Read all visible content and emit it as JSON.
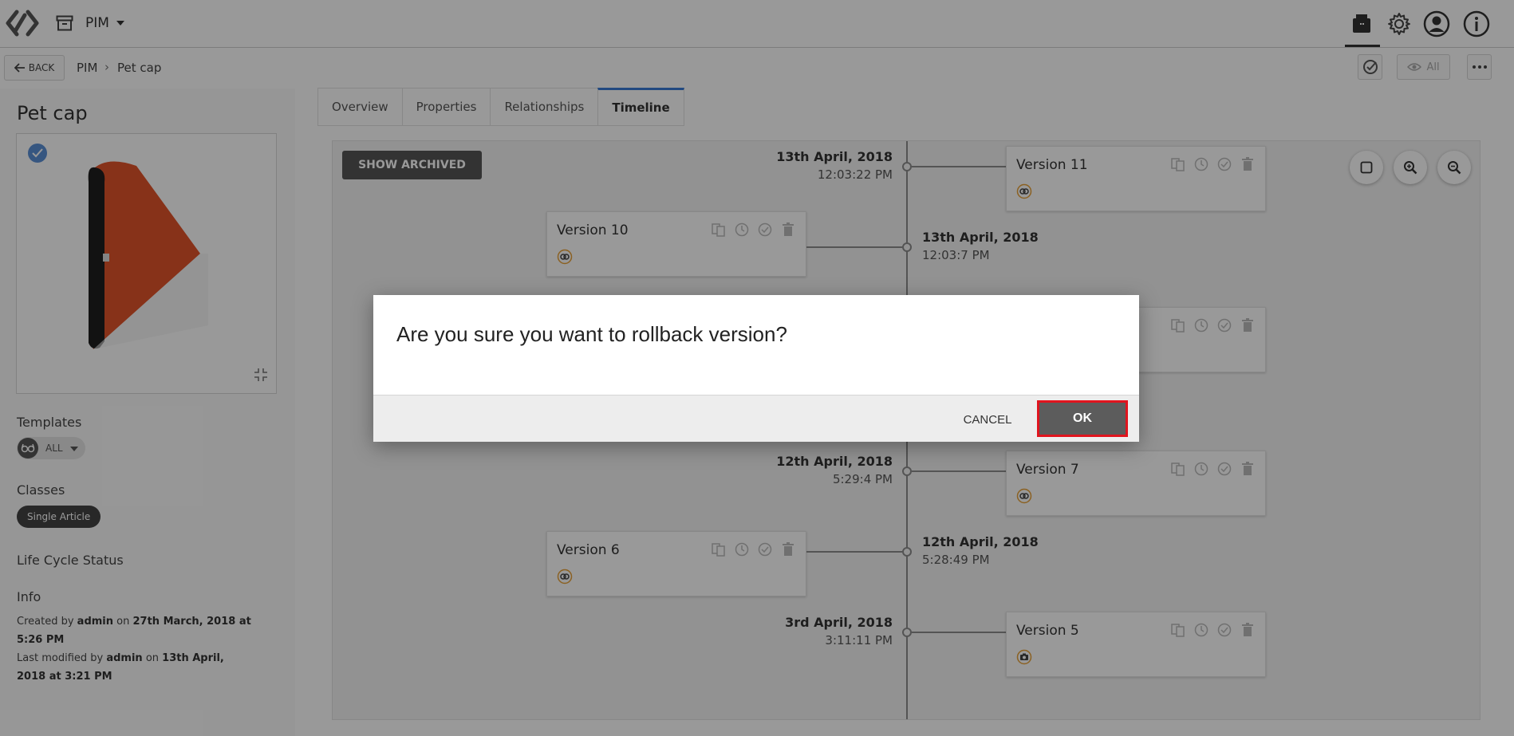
{
  "header": {
    "app_name": "PIM",
    "icons": [
      "logo-icon",
      "archive-icon",
      "product-box-icon",
      "gear-icon",
      "user-icon",
      "info-icon"
    ]
  },
  "subbar": {
    "back_label": "BACK",
    "breadcrumb": [
      "PIM",
      "Pet cap"
    ],
    "breadcrumb_sep": "›",
    "view_label": "All"
  },
  "product": {
    "title": "Pet cap",
    "templates_label": "Templates",
    "templates_value": "ALL",
    "classes_label": "Classes",
    "class_value": "Single Article",
    "lifecycle_label": "Life Cycle Status",
    "info_label": "Info",
    "created_line": [
      "Created by ",
      "admin",
      " on ",
      "27th March, 2018 at 5:26 PM"
    ],
    "modified_line": [
      "Last modified by ",
      "admin",
      " on ",
      "13th April, 2018 at 3:21 PM"
    ]
  },
  "tabs": [
    {
      "label": "Overview",
      "active": false
    },
    {
      "label": "Properties",
      "active": false
    },
    {
      "label": "Relationships",
      "active": false
    },
    {
      "label": "Timeline",
      "active": true
    }
  ],
  "timeline": {
    "show_archived_label": "SHOW ARCHIVED",
    "versions": [
      {
        "name": "Version 11",
        "date": "13th April, 2018",
        "time": "12:03:22 PM",
        "side": "right",
        "badge": "link-badge"
      },
      {
        "name": "Version 10",
        "date": "13th April, 2018",
        "time": "12:03:7 PM",
        "side": "left",
        "badge": "link-badge"
      },
      {
        "name": "Version 7",
        "date": "12th April, 2018",
        "time": "5:29:4 PM",
        "side": "right",
        "badge": "link-badge"
      },
      {
        "name": "Version 6",
        "date": "12th April, 2018",
        "time": "5:28:49 PM",
        "side": "left",
        "badge": "link-badge"
      },
      {
        "name": "Version 5",
        "date": "3rd April, 2018",
        "time": "3:11:11 PM",
        "side": "right",
        "badge": "camera-badge"
      }
    ]
  },
  "dialog": {
    "message": "Are you sure you want to rollback version?",
    "cancel_label": "CANCEL",
    "ok_label": "OK",
    "highlight_color": "#e0141e"
  },
  "colors": {
    "accent": "#3a7bd5",
    "badge_orange": "#e8a23a",
    "dark_button": "#555555"
  }
}
